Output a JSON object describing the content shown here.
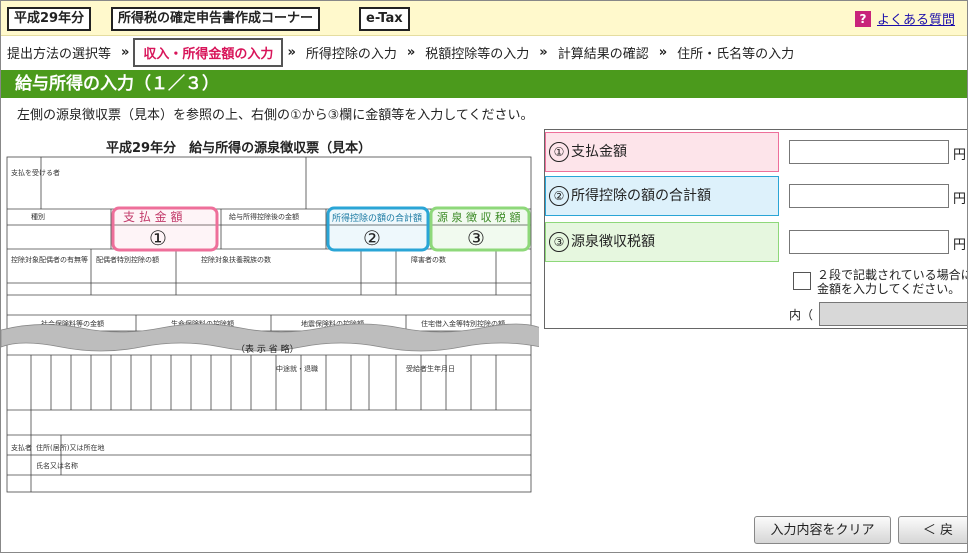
{
  "header": {
    "year_tag": "平成29年分",
    "corner_tag": "所得税の確定申告書作成コーナー",
    "etax_tag": "e-Tax",
    "help_label": "よくある質問"
  },
  "breadcrumb": [
    "提出方法の選択等",
    "収入・所得金額の入力",
    "所得控除の入力",
    "税額控除等の入力",
    "計算結果の確認",
    "住所・氏名等の入力"
  ],
  "breadcrumb_separator": "»",
  "page_title": "給与所得の入力（１／３）",
  "instruction": "左側の源泉徴収票（見本）を参照の上、右側の①から③欄に金額等を入力してください。",
  "sample": {
    "title": "平成29年分　給与所得の源泉徴収票（見本）",
    "box1": "支 払 金 額",
    "box2": "所得控除の額の合計額",
    "box3": "源 泉 徴 収 税 額",
    "mark1": "①",
    "mark2": "②",
    "mark3": "③",
    "omitted": "（表 示 省 略）",
    "left_labels": [
      "支払を受ける者",
      "種別",
      "控除対象配偶者の有無等",
      "社会保険料等の金額",
      "生命保険料の控除額",
      "地震保険料の控除額",
      "住宅借入金等特別控除の額"
    ],
    "small_labels": [
      "給与所得控除後の金額",
      "配偶者特別控除の額",
      "控除対象扶養親族の数",
      "障害者の数",
      "中途就・退職",
      "受給者生年月日",
      "支払者",
      "住所(居所)又は所在地",
      "氏名又は名称"
    ]
  },
  "form": {
    "field1": {
      "num": "①",
      "label": "支払金額",
      "value": "",
      "unit": "円"
    },
    "field2": {
      "num": "②",
      "label": "所得控除の額の合計額",
      "value": "",
      "unit": "円"
    },
    "field3": {
      "num": "③",
      "label": "源泉徴収税額",
      "value": "",
      "unit": "円"
    },
    "checkbox_note_line1": "２段で記載されている場合に",
    "checkbox_note_line2": "金額を入力してください。",
    "uchi_label": "内（"
  },
  "buttons": {
    "clear": "入力内容をクリア",
    "back": "＜ 戻"
  },
  "colors": {
    "green": "#4b9a1c",
    "pink": "#ee6f9a",
    "blue": "#2aa5d6",
    "light_green": "#8ed87a",
    "active_crumb": "#d8155a"
  }
}
